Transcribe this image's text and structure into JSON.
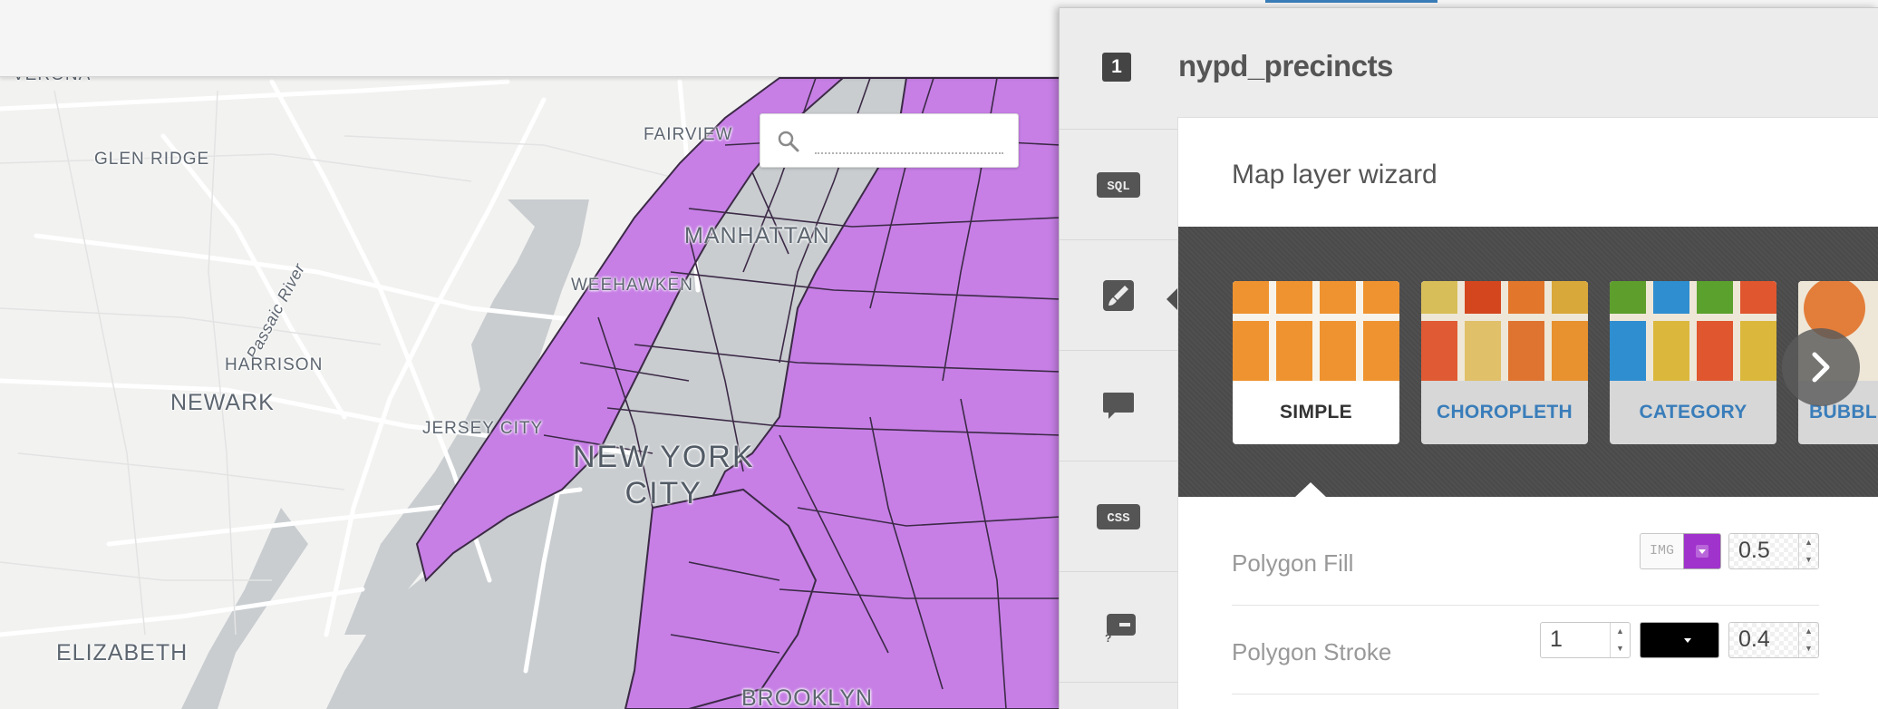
{
  "map": {
    "search": {
      "placeholder": "",
      "value": ""
    },
    "labels": {
      "verona": "VERONA",
      "fairview": "FAIRVIEW",
      "glen_ridge": "GLEN RIDGE",
      "manhattan": "MANHATTAN",
      "weehawken": "WEEHAWKEN",
      "passaic_river": "Passaic River",
      "harrison": "HARRISON",
      "newark": "NEWARK",
      "jersey_city": "JERSEY CITY",
      "new_york_line1": "NEW YORK",
      "new_york_line2": "CITY",
      "elizabeth": "ELIZABETH",
      "brooklyn": "BROOKLYN"
    },
    "colors": {
      "land": "#f2f2f1",
      "water": "#c9cdd0",
      "polygon_fill": "#c77fe6",
      "polygon_stroke": "#3c2a46",
      "road": "#ffffff"
    }
  },
  "panel": {
    "layer_number": "1",
    "layer_name": "nypd_precincts",
    "tools": [
      {
        "id": "sql",
        "icon": "sql-icon",
        "text": "SQL"
      },
      {
        "id": "wizard",
        "icon": "paintbrush-icon",
        "text": ""
      },
      {
        "id": "infowindow",
        "icon": "speech-bubble-icon",
        "text": ""
      },
      {
        "id": "css",
        "icon": "css-icon",
        "text": "CSS"
      },
      {
        "id": "legend",
        "icon": "legend-icon",
        "text": ""
      }
    ],
    "wizard": {
      "title": "Map layer wizard",
      "visualizations": [
        {
          "label": "SIMPLE",
          "selected": true
        },
        {
          "label": "CHOROPLETH",
          "selected": false
        },
        {
          "label": "CATEGORY",
          "selected": false
        },
        {
          "label": "BUBBLE",
          "selected": false
        }
      ],
      "properties": {
        "polygon_fill": {
          "label": "Polygon Fill",
          "img_label": "IMG",
          "color": "#a033cc",
          "opacity": "0.5"
        },
        "polygon_stroke": {
          "label": "Polygon Stroke",
          "width": "1",
          "color": "#000000",
          "opacity": "0.4"
        }
      }
    }
  }
}
